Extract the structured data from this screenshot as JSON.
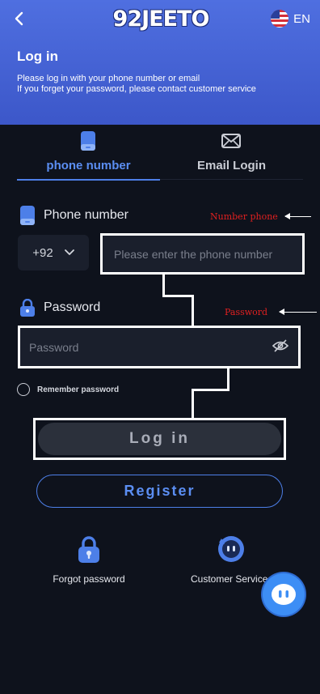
{
  "header": {
    "logo_text": "92JEETO",
    "language": "EN",
    "title": "Log in",
    "desc_line1": "Please log in with your phone number or email",
    "desc_line2": "If you forget your password, please contact customer service"
  },
  "tabs": [
    {
      "label": "phone number",
      "icon": "phone-icon",
      "active": true
    },
    {
      "label": "Email Login",
      "icon": "email-icon",
      "active": false
    }
  ],
  "phone": {
    "label": "Phone number",
    "country_code": "+92",
    "placeholder": "Please enter the phone number"
  },
  "password": {
    "label": "Password",
    "placeholder": "Password"
  },
  "annotations": {
    "phone_note": "Number phone",
    "password_note": "Password"
  },
  "remember_label": "Remember password",
  "buttons": {
    "login": "Log in",
    "register": "Register"
  },
  "bottom_links": {
    "forgot": "Forgot password",
    "support": "Customer Service"
  },
  "colors": {
    "header_bg": "#4562d6",
    "page_bg": "#0e121c",
    "accent": "#5b8ef2",
    "annotation": "#e02020"
  }
}
